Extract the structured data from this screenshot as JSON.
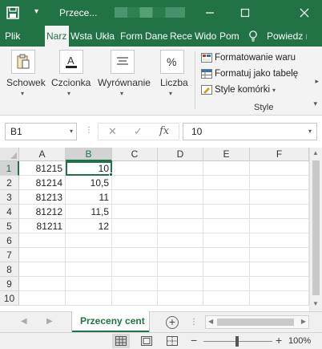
{
  "titlebar": {
    "title": "Przece...",
    "colors": {
      "brand": "#217346"
    }
  },
  "ribbon_tabs": [
    {
      "label": "Plik"
    },
    {
      "label": "Narz"
    },
    {
      "label": "Wsta"
    },
    {
      "label": "Ukła"
    },
    {
      "label": "Form"
    },
    {
      "label": "Dane"
    },
    {
      "label": "Rece"
    },
    {
      "label": "Wido"
    },
    {
      "label": "Pom"
    },
    {
      "label": "Powiedz m"
    }
  ],
  "ribbon": {
    "clipboard_label": "Schowek",
    "font_label": "Czcionka",
    "alignment_label": "Wyrównanie",
    "number_label": "Liczba",
    "styles": {
      "conditional": "Formatowanie waru",
      "as_table": "Formatuj jako tabelę",
      "cell_styles": "Style komórki",
      "group_label": "Style"
    }
  },
  "formula_bar": {
    "name_box": "B1",
    "cancel_glyph": "✕",
    "enter_glyph": "✓",
    "fx_glyph": "fx",
    "value": "10"
  },
  "grid": {
    "columns": [
      "A",
      "B",
      "C",
      "D",
      "E",
      "F"
    ],
    "rows": [
      "1",
      "2",
      "3",
      "4",
      "5",
      "6",
      "7",
      "8",
      "9",
      "10"
    ],
    "selected_column": "B",
    "selected_row": "1",
    "cells": [
      [
        "81215",
        "10"
      ],
      [
        "81214",
        "10,5"
      ],
      [
        "81213",
        "11"
      ],
      [
        "81212",
        "11,5"
      ],
      [
        "81211",
        "12"
      ]
    ]
  },
  "sheets": {
    "active_tab": "Przeceny cent",
    "add_glyph": "+"
  },
  "status": {
    "zoom": "100%",
    "zoom_minus": "−",
    "zoom_plus": "+"
  }
}
